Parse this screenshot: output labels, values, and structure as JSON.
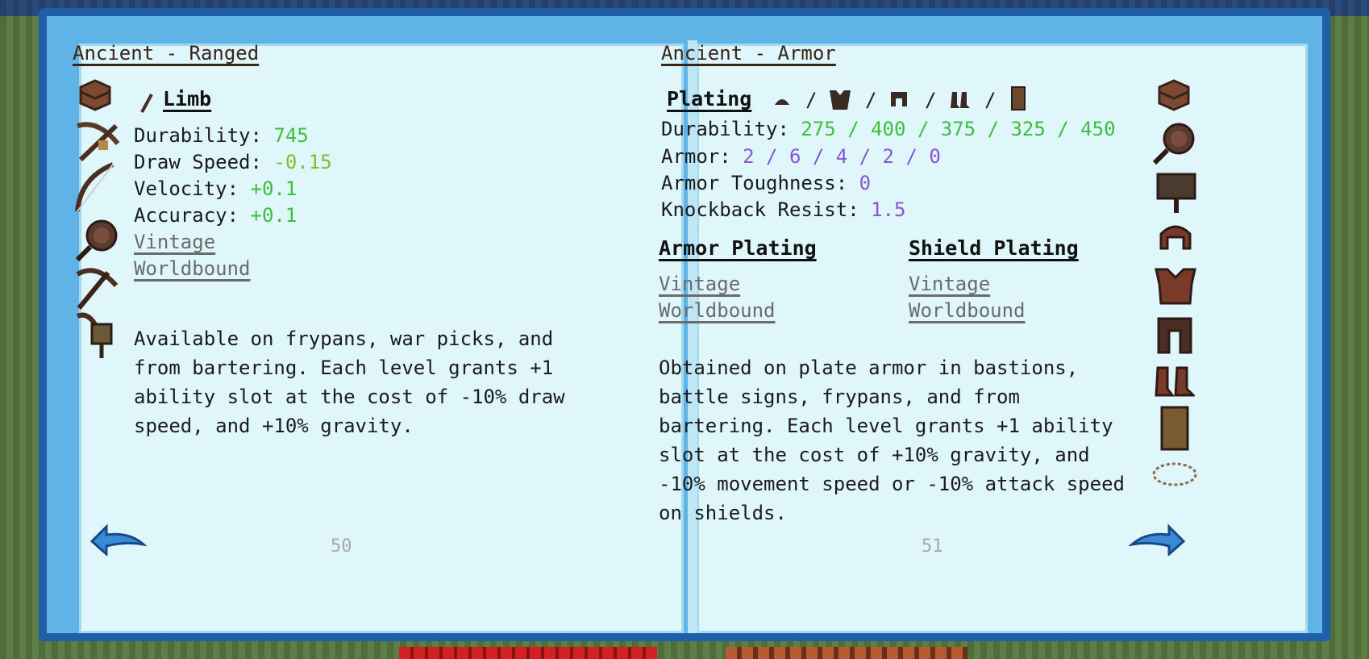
{
  "left_page": {
    "section_title": "Ancient - Ranged",
    "part_title": "Limb",
    "stats": [
      {
        "label": "Durability: ",
        "value": "745"
      },
      {
        "label": "Draw Speed: ",
        "value": "-0.15"
      },
      {
        "label": "Velocity: ",
        "value": "+0.1"
      },
      {
        "label": "Accuracy: ",
        "value": "+0.1"
      }
    ],
    "traits": [
      "Vintage",
      "Worldbound"
    ],
    "description": "Available on frypans, war picks, and from bartering. Each level grants +1 ability slot at the cost of -10% draw speed, and +10% gravity.",
    "page_number": "50",
    "icons": [
      "leather-chest-icon",
      "crossbow-icon",
      "bow-icon",
      "frypan-icon",
      "war-pick-icon",
      "mace-icon"
    ]
  },
  "right_page": {
    "section_title": "Ancient - Armor",
    "part_title": "Plating",
    "slot_separator": "/",
    "stats": [
      {
        "label": "Durability: ",
        "value": "275 / 400 / 375 / 325 / 450",
        "color": "green"
      },
      {
        "label": "Armor: ",
        "value": "2 / 6 / 4 / 2 / 0",
        "color": "purple"
      },
      {
        "label": "Armor Toughness: ",
        "value": "0",
        "color": "purple"
      },
      {
        "label": "Knockback Resist: ",
        "value": "1.5",
        "color": "purple"
      }
    ],
    "armor_plating": {
      "title": "Armor Plating",
      "traits": [
        "Vintage",
        "Worldbound"
      ]
    },
    "shield_plating": {
      "title": "Shield Plating",
      "traits": [
        "Vintage",
        "Worldbound"
      ]
    },
    "description": "Obtained on plate armor in bastions, battle signs, frypans, and from bartering. Each level grants +1 ability slot at the cost of +10% gravity, and -10% movement speed or -10% attack speed on shields.",
    "page_number": "51",
    "icons": [
      "leather-chest-icon",
      "frypan-icon",
      "battle-sign-icon",
      "helmet-icon",
      "chestplate-icon",
      "leggings-icon",
      "boots-icon",
      "shield-icon",
      "chain-icon"
    ]
  },
  "colors": {
    "green": "#3cbf3c",
    "purple": "#8a55d4",
    "page": "#dff6fb",
    "cover": "#1f5fa8"
  }
}
